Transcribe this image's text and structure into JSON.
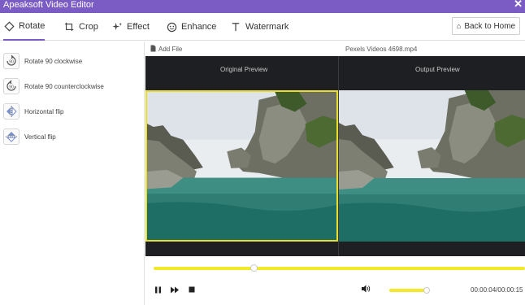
{
  "window": {
    "title": "Apeaksoft Video Editor",
    "close_glyph": "✕"
  },
  "tabs": [
    {
      "label": "Rotate",
      "icon": "rotate-icon",
      "active": true
    },
    {
      "label": "Crop",
      "icon": "crop-icon",
      "active": false
    },
    {
      "label": "Effect",
      "icon": "effect-icon",
      "active": false
    },
    {
      "label": "Enhance",
      "icon": "enhance-icon",
      "active": false
    },
    {
      "label": "Watermark",
      "icon": "watermark-icon",
      "active": false
    }
  ],
  "back_home": {
    "label": "Back to Home",
    "icon": "home-icon"
  },
  "rotate_options": [
    {
      "label": "Rotate 90 clockwise",
      "icon": "rotate-clockwise-icon",
      "badge": "90"
    },
    {
      "label": "Rotate 90 counterclockwise",
      "icon": "rotate-counterclockwise-icon",
      "badge": "90"
    },
    {
      "label": "Horizontal flip",
      "icon": "horizontal-flip-icon"
    },
    {
      "label": "Vertical flip",
      "icon": "vertical-flip-icon"
    }
  ],
  "file": {
    "add_label": "Add File",
    "name": "Pexels Videos 4698.mp4"
  },
  "preview": {
    "original_label": "Original Preview",
    "output_label": "Output Preview"
  },
  "playback": {
    "progress": 0.27,
    "volume": 0.92,
    "timecode": "00:00:04/00:00:15"
  },
  "colors": {
    "accent": "#7b5cc4",
    "highlight": "#e9de2c",
    "track": "#f3e92b"
  }
}
